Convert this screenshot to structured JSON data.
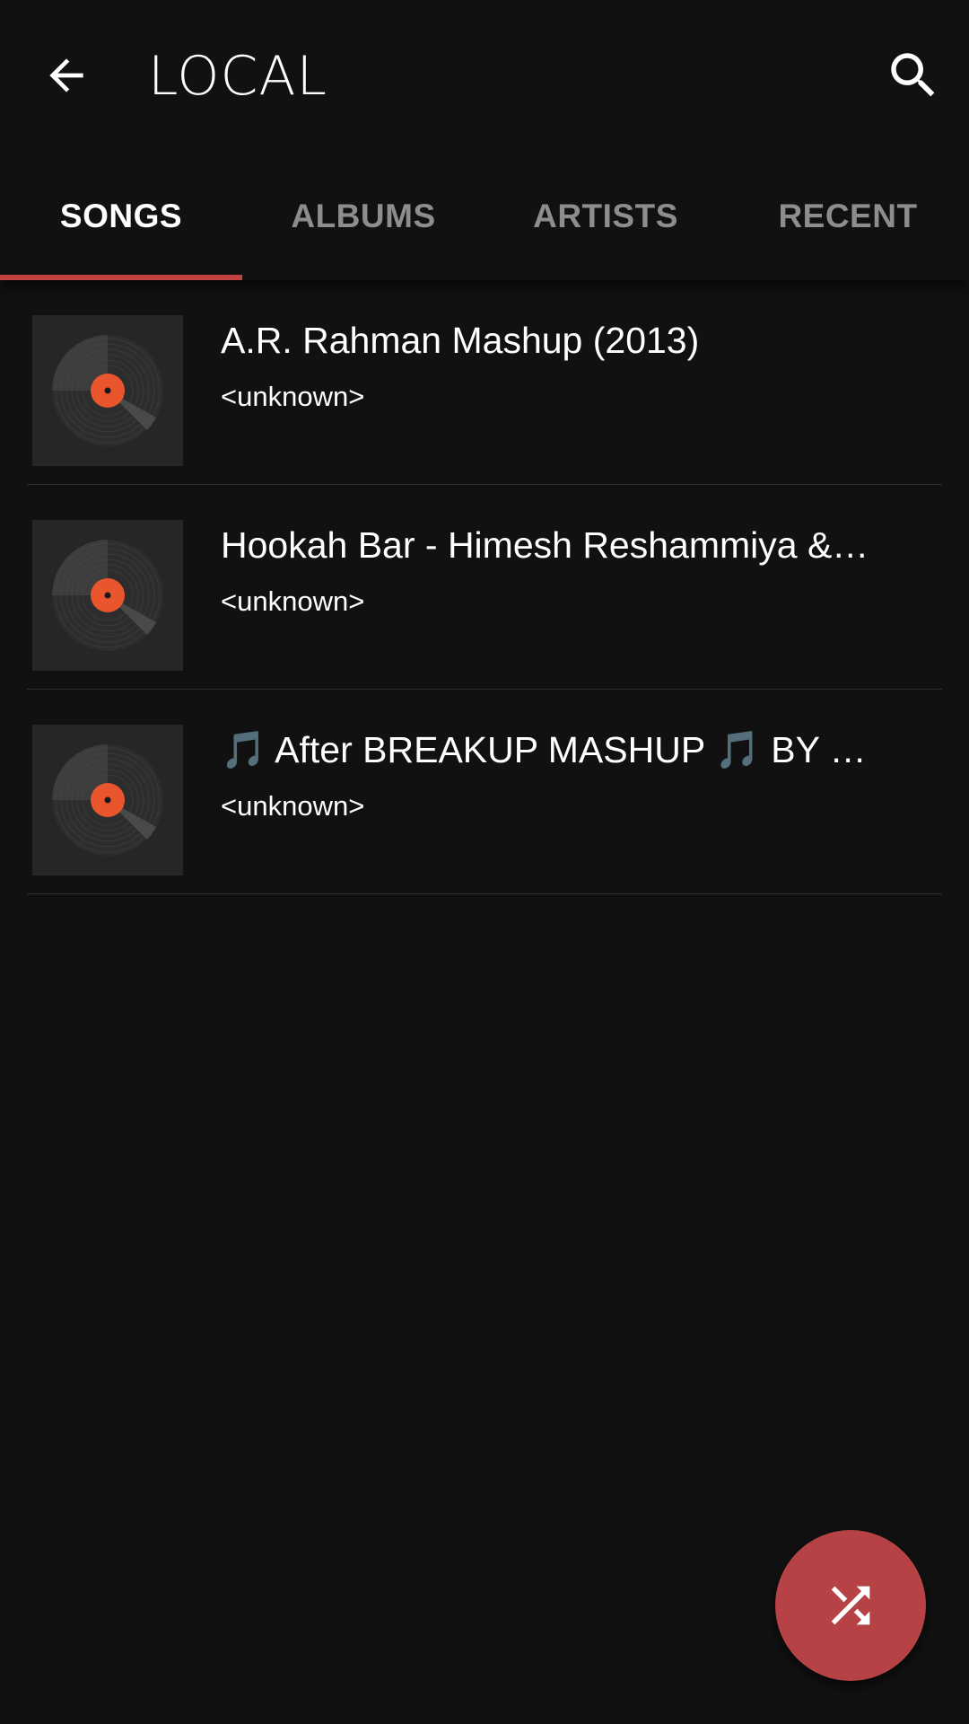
{
  "header": {
    "title": "LOCAL",
    "back_icon": "arrow-left-icon",
    "search_icon": "search-icon"
  },
  "tabs": [
    {
      "label": "SONGS",
      "active": true
    },
    {
      "label": "ALBUMS",
      "active": false
    },
    {
      "label": "ARTISTS",
      "active": false
    },
    {
      "label": "RECENT",
      "active": false
    }
  ],
  "songs": [
    {
      "title": "A.R. Rahman Mashup (2013)",
      "artist": "<unknown>",
      "art_icon": "vinyl-record-icon"
    },
    {
      "title": "Hookah Bar - Himesh Reshammiya &…",
      "artist": "<unknown>",
      "art_icon": "vinyl-record-icon"
    },
    {
      "title": "🎵 After BREAKUP MASHUP 🎵 BY Dj…",
      "artist": "<unknown>",
      "art_icon": "vinyl-record-icon"
    }
  ],
  "fab": {
    "icon": "shuffle-icon"
  },
  "colors": {
    "background": "#111111",
    "accent": "#c54040",
    "fab": "#b64245",
    "record_label": "#e9552c",
    "tab_inactive": "#8d8d8d"
  }
}
